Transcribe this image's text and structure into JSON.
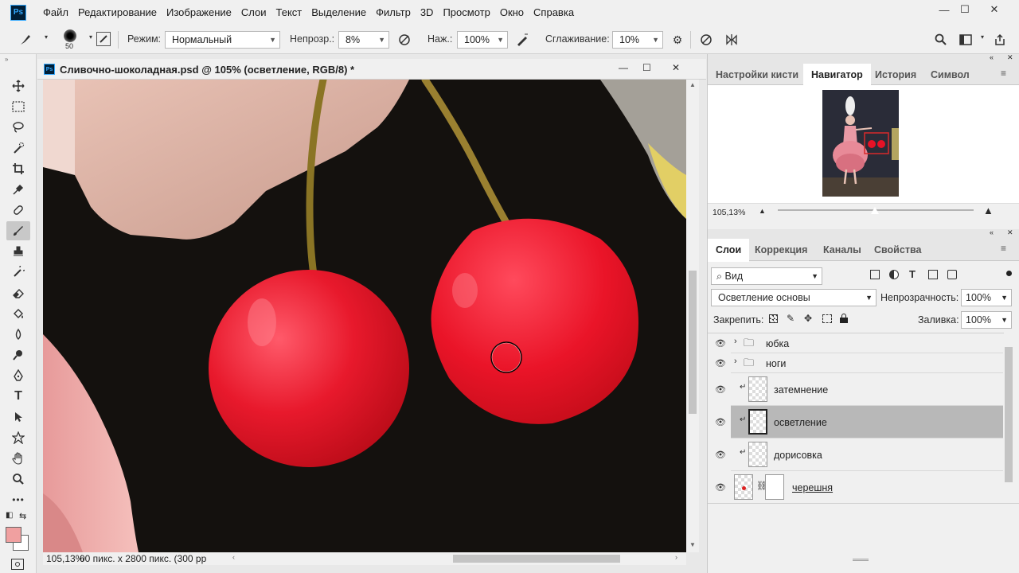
{
  "app": {
    "logo": "Ps"
  },
  "menu": [
    "Файл",
    "Редактирование",
    "Изображение",
    "Слои",
    "Текст",
    "Выделение",
    "Фильтр",
    "3D",
    "Просмотр",
    "Окно",
    "Справка"
  ],
  "window_controls": {
    "minimize": "—",
    "maximize": "☐",
    "close": "✕"
  },
  "options": {
    "brush_size": "50",
    "mode_label": "Режим:",
    "mode_value": "Нормальный",
    "opacity_label": "Непрозр.:",
    "opacity_value": "8%",
    "pressure_label": "Наж.:",
    "pressure_value": "100%",
    "smoothing_label": "Сглаживание:",
    "smoothing_value": "10%"
  },
  "document": {
    "title": "Сливочно-шоколадная.psd @ 105% (осветление, RGB/8) *",
    "zoom": "105,13%",
    "size_info": "00 пикс. x 2800 пикс. (300 pp"
  },
  "navigator": {
    "tabs": [
      "Настройки кисти",
      "Навигатор",
      "История",
      "Символ"
    ],
    "active_tab": "Навигатор",
    "zoom": "105,13%"
  },
  "layers_panel": {
    "tabs": [
      "Слои",
      "Коррекция",
      "Каналы",
      "Свойства"
    ],
    "active_tab": "Слои",
    "filter_label": "Вид",
    "blend_mode": "Осветление основы",
    "opacity_label": "Непрозрачность:",
    "opacity_value": "100%",
    "lock_label": "Закрепить:",
    "fill_label": "Заливка:",
    "fill_value": "100%",
    "layers": [
      {
        "name": "юбка",
        "type": "group"
      },
      {
        "name": "ноги",
        "type": "group"
      },
      {
        "name": "затемнение",
        "type": "clipped"
      },
      {
        "name": "осветление",
        "type": "clipped",
        "selected": true
      },
      {
        "name": "дорисовка",
        "type": "clipped"
      },
      {
        "name": "черешня",
        "type": "masked"
      }
    ]
  },
  "colors": {
    "accent": "#31a8ff",
    "foreground": "#f0a0a0",
    "background": "#ffffff"
  }
}
